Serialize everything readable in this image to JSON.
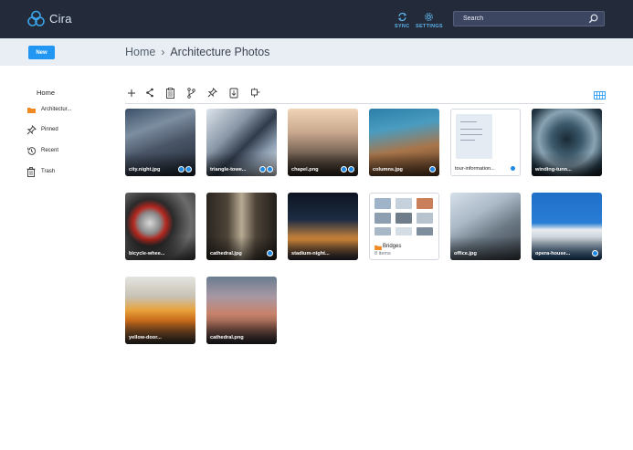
{
  "app": {
    "name": "Cira"
  },
  "topbar": {
    "sync_label": "SYNC",
    "settings_label": "SETTINGS",
    "search_placeholder": "Search"
  },
  "actions": {
    "new_label": "New"
  },
  "breadcrumb": {
    "root": "Home",
    "separator": "›",
    "current": "Architecture Photos"
  },
  "sidebar": {
    "home": "Home",
    "items": [
      {
        "label": "Architectur...",
        "icon": "folder-icon"
      },
      {
        "label": "Pinned",
        "icon": "pin-icon"
      },
      {
        "label": "Recent",
        "icon": "history-icon"
      },
      {
        "label": "Trash",
        "icon": "trash-icon"
      }
    ]
  },
  "toolbar": {
    "tools": [
      "add-icon",
      "share-icon",
      "clipboard-icon",
      "branch-icon",
      "pin-icon",
      "download-icon",
      "crop-icon"
    ],
    "view": "grid-view-icon"
  },
  "files": [
    {
      "name": "city.night.jpg",
      "badges": 2
    },
    {
      "name": "triangle-towe...",
      "badges": 2
    },
    {
      "name": "chapel.png",
      "badges": 2
    },
    {
      "name": "columns.jpg",
      "badges": 1
    },
    {
      "name": "tour-information...",
      "badges": 1
    },
    {
      "name": "winding-tunn...",
      "badges": 0
    },
    {
      "name": "bicycle-whee...",
      "badges": 0
    },
    {
      "name": "cathedral.jpg",
      "badges": 1
    },
    {
      "name": "stadium-night...",
      "badges": 0
    },
    {
      "name": "Bridges",
      "count": "8 items"
    },
    {
      "name": "office.jpg",
      "badges": 0
    },
    {
      "name": "opera-house...",
      "badges": 1
    },
    {
      "name": "yellow-door...",
      "badges": 0
    },
    {
      "name": "cathedral.png",
      "badges": 0
    }
  ],
  "colors": {
    "topbar": "#232a3a",
    "accent": "#2196f3",
    "subbar": "#e9eef5"
  }
}
